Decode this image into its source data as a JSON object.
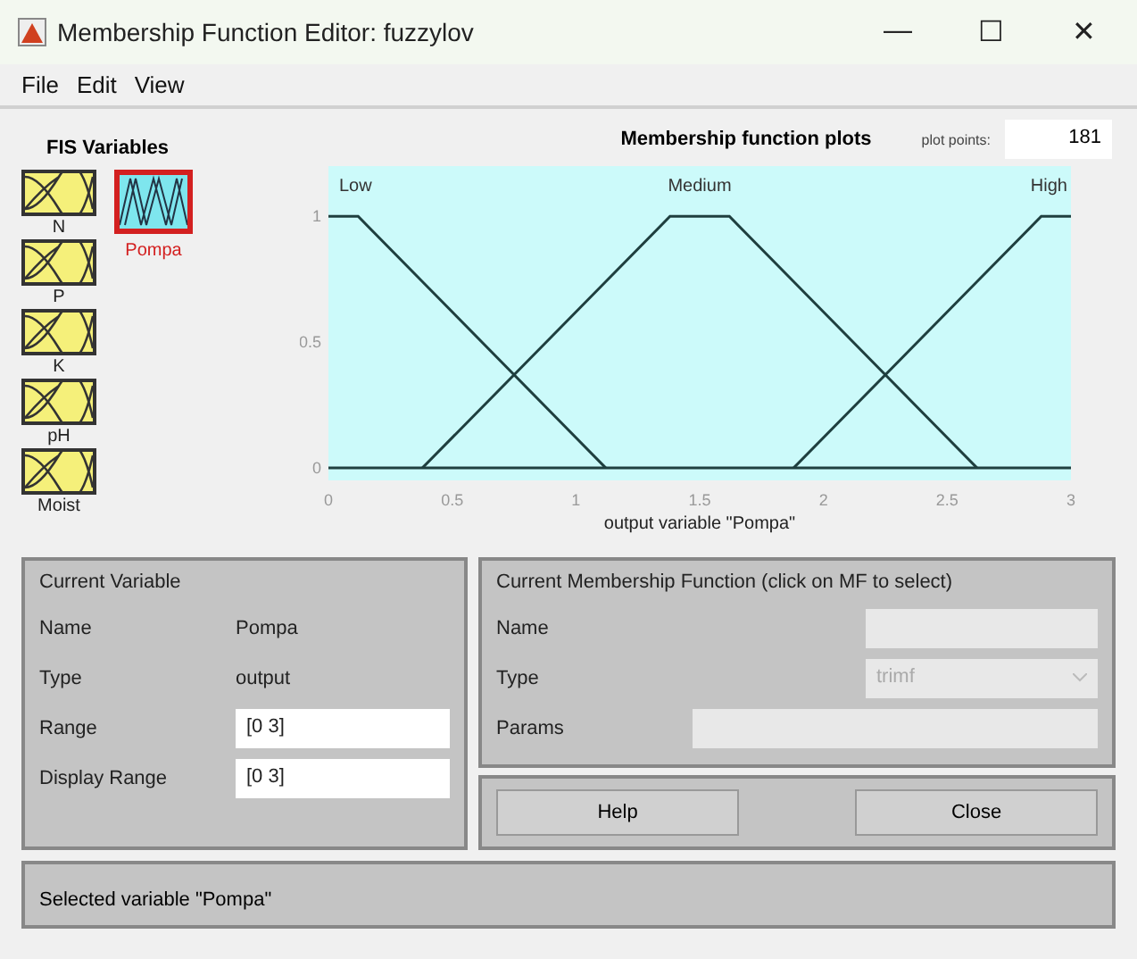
{
  "window": {
    "title": "Membership Function Editor: fuzzylov",
    "controls": [
      "—",
      "☐",
      "✕"
    ]
  },
  "menu": [
    "File",
    "Edit",
    "View"
  ],
  "fis_variables": {
    "title": "FIS Variables",
    "inputs": [
      {
        "label": "N",
        "selected": false
      },
      {
        "label": "P",
        "selected": false
      },
      {
        "label": "K",
        "selected": false
      },
      {
        "label": "pH",
        "selected": false
      },
      {
        "label": "Moist",
        "selected": false
      }
    ],
    "outputs": [
      {
        "label": "Pompa",
        "selected": true
      }
    ]
  },
  "plot": {
    "title": "Membership function plots",
    "plot_points_label": "plot points:",
    "plot_points": "181",
    "chart_data": {
      "type": "line",
      "xlabel": "output variable \"Pompa\"",
      "x": [
        0,
        0.12,
        0.38,
        1.12,
        1.38,
        1.62,
        1.88,
        2.62,
        2.88,
        3
      ],
      "series": [
        {
          "name": "Low",
          "color": "#1f3f3f",
          "values": [
            1,
            1,
            0.74,
            0,
            null,
            null,
            null,
            null,
            null,
            null
          ]
        },
        {
          "name": "Medium",
          "color": "#1f3f3f",
          "values": [
            null,
            null,
            0,
            0.74,
            1,
            1,
            0.74,
            0,
            null,
            null
          ]
        },
        {
          "name": "High",
          "color": "#1f3f3f",
          "values": [
            null,
            null,
            null,
            null,
            null,
            null,
            0,
            0.74,
            1,
            1
          ]
        }
      ],
      "xlim": [
        0,
        3
      ],
      "ylim": [
        -0.05,
        1.2
      ],
      "xticks": [
        0,
        0.5,
        1,
        1.5,
        2,
        2.5,
        3
      ],
      "yticks": [
        0,
        0.5,
        1
      ]
    }
  },
  "current_variable": {
    "title": "Current Variable",
    "name_label": "Name",
    "name": "Pompa",
    "type_label": "Type",
    "type": "output",
    "range_label": "Range",
    "range": "[0 3]",
    "display_range_label": "Display Range",
    "display_range": "[0 3]"
  },
  "current_mf": {
    "title": "Current Membership Function (click on MF to select)",
    "name_label": "Name",
    "type_label": "Type",
    "type": "trimf",
    "params_label": "Params"
  },
  "buttons": [
    "Help",
    "Close"
  ],
  "status_bar": "Selected variable \"Pompa\""
}
